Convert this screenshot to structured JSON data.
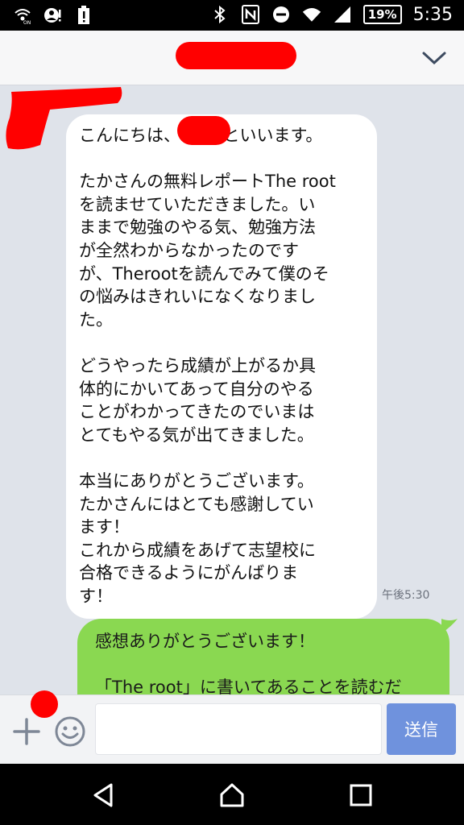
{
  "status_bar": {
    "battery": "19%",
    "time": "5:35",
    "icons": [
      "wifi-calling-icon",
      "account-alert-icon",
      "battery-alert-icon",
      "bluetooth-icon",
      "nfc-icon",
      "do-not-disturb-icon",
      "wifi-icon",
      "signal-icon"
    ]
  },
  "colors": {
    "outgoing_bubble": "#8ad851",
    "send_button": "#6f92dd",
    "background": "#dfe3ea",
    "redaction": "#ff0000"
  },
  "messages": {
    "incoming": {
      "text": "こんにちは、　　　といいます。\n\nたかさんの無料レポートThe root\nを読ませていただきました。い\nままで勉強のやる気、勉強方法\nが全然わからなかったのです\nが、Therootを読んでみて僕のそ\nの悩みはきれいになくなりまし\nた。\n\nどうやったら成績が上がるか具\n体的にかいてあって自分のやる\nことがわかってきたのでいまは\nとてもやる気が出てきました。\n\n本当にありがとうございます。\nたかさんにはとても感謝してい\nます！\nこれから成績をあげて志望校に\n合格できるようにがんばりま\nす！",
      "time": "午後5:30"
    },
    "outgoing": {
      "text": "感想ありがとうございます！\n\n「The root」に書いてあることを読むだ"
    }
  },
  "input": {
    "value": "",
    "send_label": "送信"
  }
}
